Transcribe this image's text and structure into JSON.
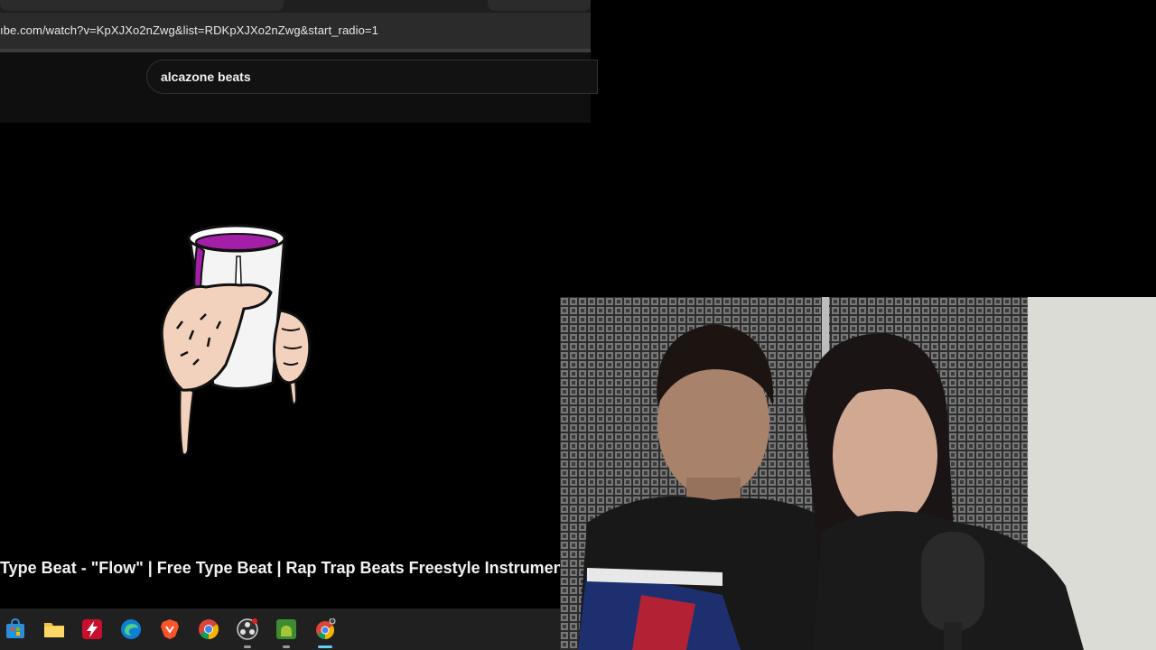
{
  "browser": {
    "address_url": "ıbe.com/watch?v=KpXJXo2nZwg&list=RDKpXJXo2nZwg&start_radio=1"
  },
  "youtube": {
    "search_value": "alcazone beats",
    "video_title": "Type Beat - \"Flow\" | Free Type Beat | Rap Trap Beats Freestyle Instrumen"
  },
  "taskbar": {
    "icons": [
      "store-icon",
      "folder-icon",
      "lightning-app-icon",
      "edge-icon",
      "brave-icon",
      "chrome-icon",
      "obs-icon",
      "android-icon",
      "chrome-profile-icon"
    ]
  },
  "colors": {
    "background": "#000000",
    "address_bar": "#2b2b2b",
    "taskbar": "#202020",
    "lean_purple": "#a31fa8"
  }
}
